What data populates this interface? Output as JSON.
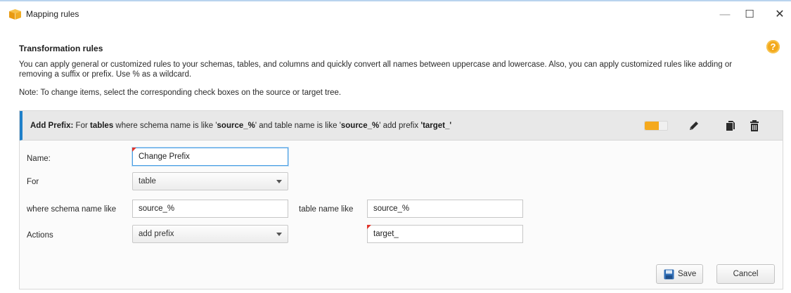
{
  "window": {
    "title": "Mapping rules",
    "controls": {
      "minimize": "—",
      "maximize": "☐",
      "close": "✕"
    }
  },
  "section": {
    "title": "Transformation rules",
    "help_glyph": "?",
    "description": "You can apply general or customized rules to your schemas, tables, and columns and quickly convert all names between uppercase and lowercase. Also, you can apply customized rules like adding or removing a suffix or prefix. Use % as a wildcard.",
    "note": "Note: To change items, select the corresponding check boxes on the source or target tree."
  },
  "rule": {
    "summary": {
      "type_label": "Add Prefix:",
      "for_text": " For ",
      "object": "tables",
      "schema_text": " where schema name is like '",
      "schema_value": "source_%",
      "table_text": "' and table name is like '",
      "table_value": "source_%",
      "action_text": "' add prefix ",
      "prefix_value": "'target_'"
    },
    "toggle": {
      "enabled": true,
      "accent": "#f5a91d"
    },
    "icons": [
      "pencil-icon",
      "copy-icon",
      "trash-icon"
    ]
  },
  "form": {
    "name_label": "Name:",
    "name_value": "Change Prefix",
    "for_label": "For",
    "for_value": "table",
    "schema_label": "where schema name like",
    "schema_value": "source_%",
    "table_label": "table name like",
    "table_value": "source_%",
    "actions_label": "Actions",
    "actions_value": "add prefix",
    "prefix_value": "target_"
  },
  "buttons": {
    "save": "Save",
    "cancel": "Cancel"
  },
  "colors": {
    "accent_bar": "#1e7fc9",
    "help": "#f3a91b",
    "required_marker": "#e0342b"
  }
}
